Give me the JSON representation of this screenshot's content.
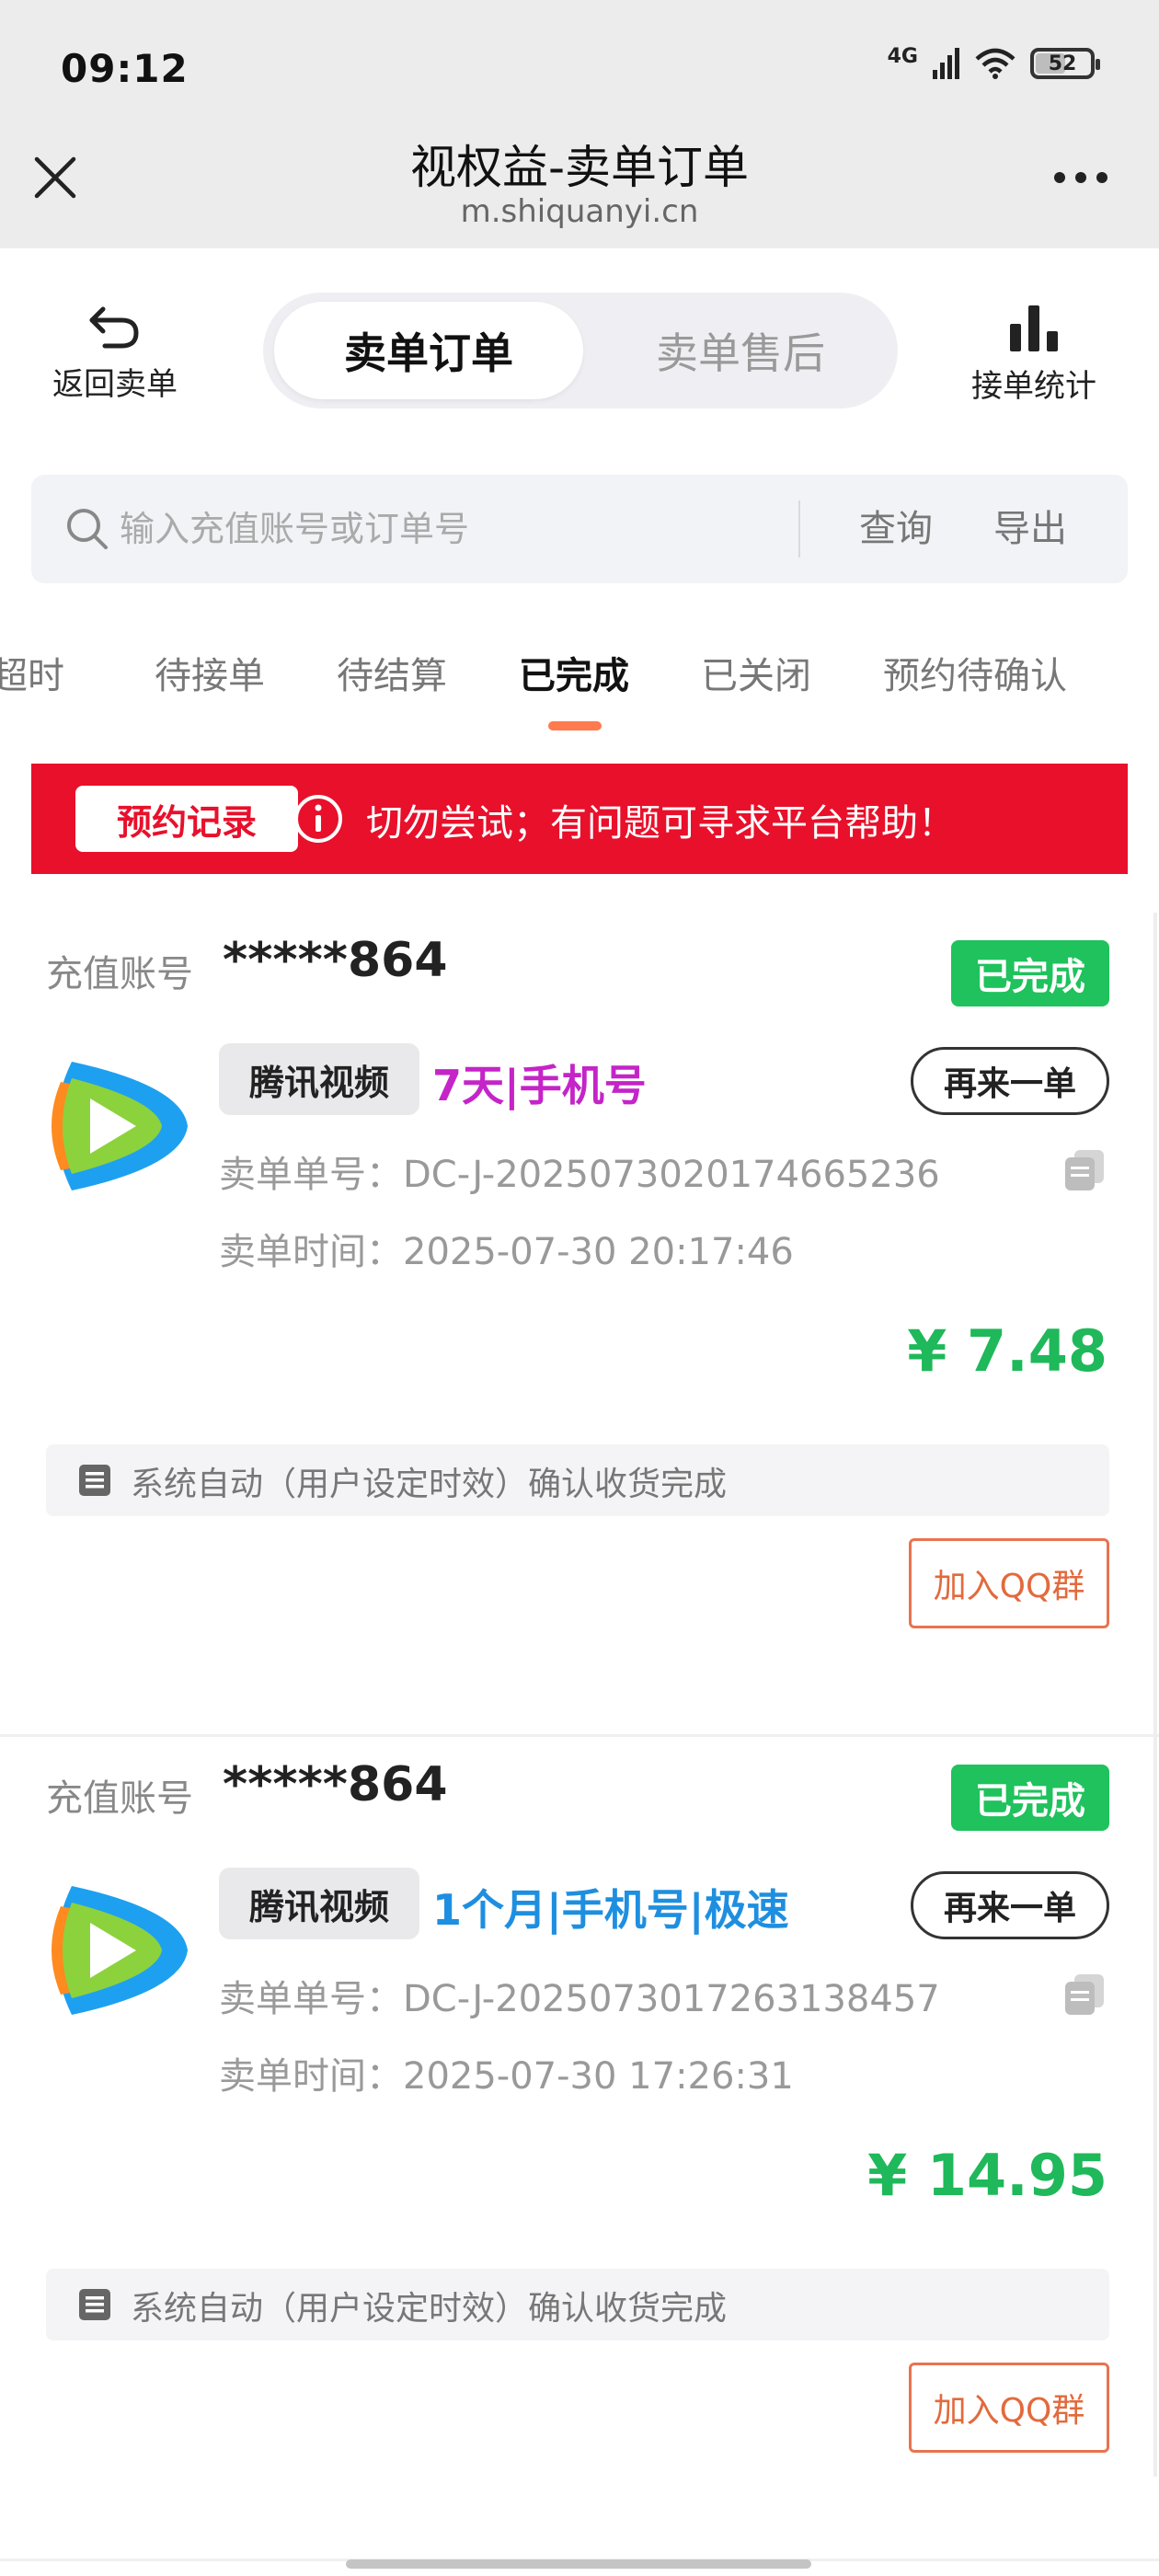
{
  "status_bar": {
    "time": "09:12",
    "network": "4G",
    "battery": "52"
  },
  "titlebar": {
    "title": "视权益-卖单订单",
    "url": "m.shiquanyi.cn"
  },
  "header": {
    "back_label": "返回卖单",
    "tabs": [
      {
        "label": "卖单订单",
        "active": true
      },
      {
        "label": "卖单售后",
        "active": false
      }
    ],
    "stats_label": "接单统计"
  },
  "search": {
    "placeholder": "输入充值账号或订单号",
    "query_label": "查询",
    "export_label": "导出"
  },
  "status_tabs": [
    {
      "label": "超时",
      "active": false
    },
    {
      "label": "待接单",
      "active": false
    },
    {
      "label": "待结算",
      "active": false
    },
    {
      "label": "已完成",
      "active": true
    },
    {
      "label": "已关闭",
      "active": false
    },
    {
      "label": "预约待确认",
      "active": false
    }
  ],
  "notice": {
    "tag": "预约记录",
    "text": "切勿尝试；有问题可寻求平台帮助！"
  },
  "colors": {
    "accent_red": "#e8102b",
    "success_green": "#1fc25c",
    "price_green": "#1fb85a",
    "tab_indicator": "#ff7a4f",
    "qq_orange": "#e26a3d"
  },
  "orders": [
    {
      "account_label": "充值账号",
      "account": "*****864",
      "status": "已完成",
      "platform": "腾讯视频",
      "product": "7天|手机号",
      "product_color": "#c424c8",
      "reorder_label": "再来一单",
      "order_no": "卖单单号：DC-J-2025073020174665236",
      "order_time": "卖单时间：2025-07-30 20:17:46",
      "price": "¥ 7.48",
      "note": "系统自动（用户设定时效）确认收货完成",
      "qq_label": "加入QQ群"
    },
    {
      "account_label": "充值账号",
      "account": "*****864",
      "status": "已完成",
      "platform": "腾讯视频",
      "product": "1个月|手机号|极速",
      "product_color": "#1e8fe0",
      "reorder_label": "再来一单",
      "order_no": "卖单单号：DC-J-2025073017263138457",
      "order_time": "卖单时间：2025-07-30 17:26:31",
      "price": "¥ 14.95",
      "note": "系统自动（用户设定时效）确认收货完成",
      "qq_label": "加入QQ群"
    }
  ]
}
